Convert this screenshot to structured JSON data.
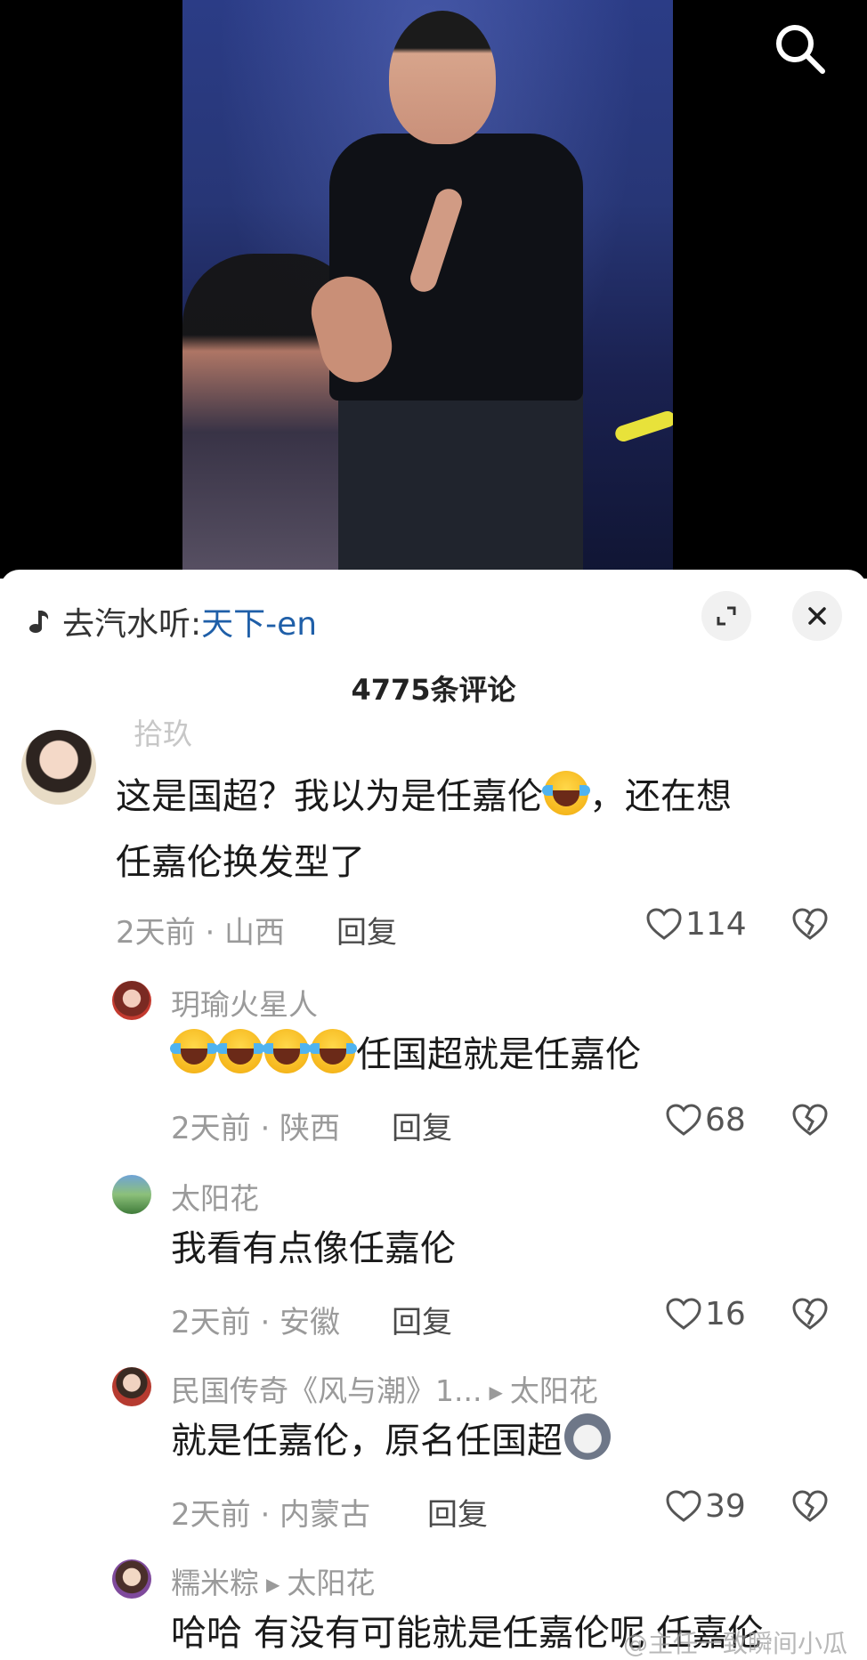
{
  "music": {
    "prefix": "去汽水听: ",
    "song": "天下-en"
  },
  "comment_count": "4775条评论",
  "partial_username": "拾玖",
  "comments": [
    {
      "text_line1": "这是国超？我以为是任嘉伦",
      "text_line1_after": "，还在想",
      "text_line2": "任嘉伦换发型了",
      "time": "2天前 · 山西",
      "reply": "回复",
      "likes": "114"
    },
    {
      "username": "玥瑜火星人",
      "text": "任国超就是任嘉伦",
      "time": "2天前 · 陕西",
      "reply": "回复",
      "likes": "68"
    },
    {
      "username": "太阳花",
      "text": "我看有点像任嘉伦",
      "time": "2天前 · 安徽",
      "reply": "回复",
      "likes": "16"
    },
    {
      "username": "民国传奇《风与潮》1...",
      "reply_to": "太阳花",
      "text": "就是任嘉伦，原名任国超",
      "time": "2天前 · 内蒙古",
      "reply": "回复",
      "likes": "39"
    },
    {
      "username": "糯米粽",
      "reply_to": "太阳花",
      "text": "哈哈 有没有可能就是任嘉伦呢 任嘉伦"
    }
  ],
  "watermark": "@主任一致瞬间小瓜",
  "icons": {
    "search": "search-icon",
    "music": "music-note-icon",
    "expand": "expand-icon",
    "close": "close-icon",
    "like": "heart-icon",
    "dislike": "broken-heart-icon"
  },
  "colors": {
    "link": "#1f5fa8",
    "muted": "#9a9a9a",
    "text": "#1a1a1a"
  }
}
